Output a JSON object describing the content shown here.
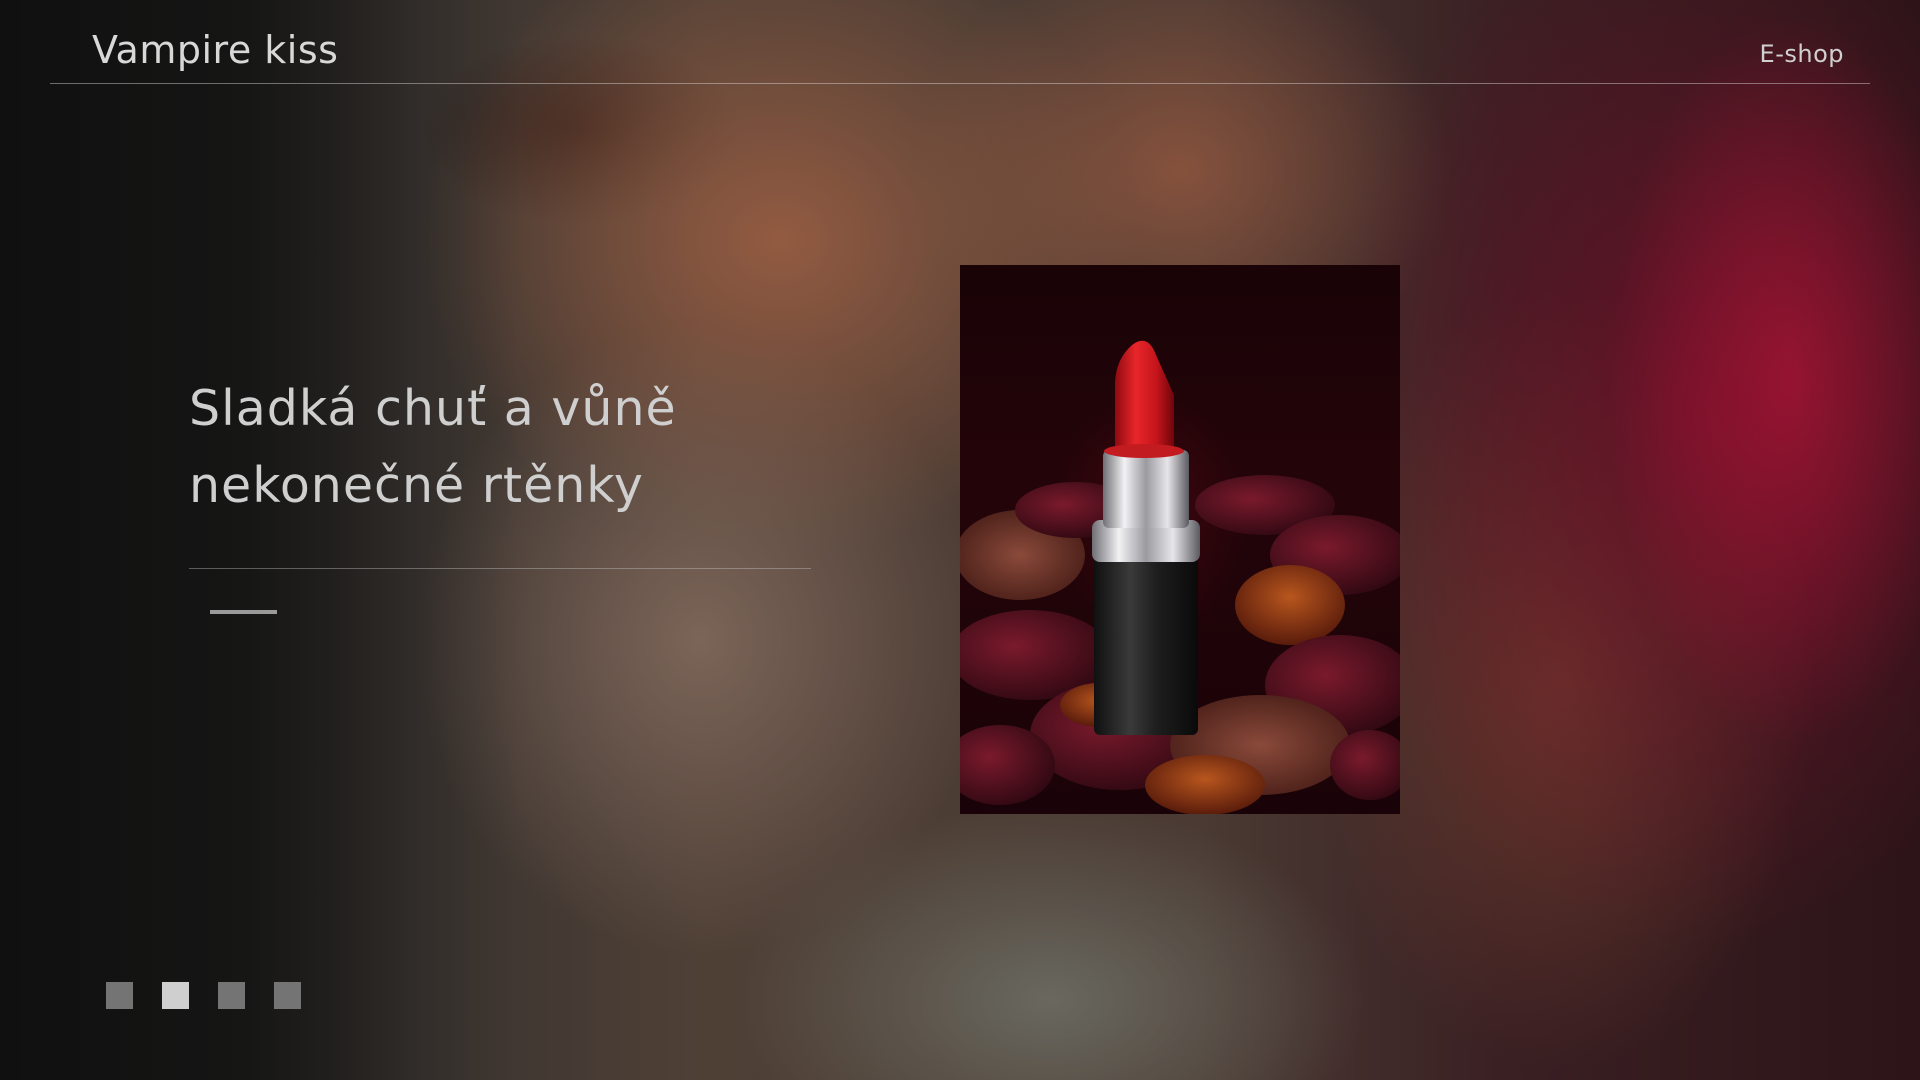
{
  "header": {
    "brand": "Vampire kiss",
    "nav_link": "E-shop"
  },
  "hero": {
    "headline_line1": "Sladká chuť  a vůně",
    "headline_line2": "nekonečné rtěnky"
  },
  "pager": {
    "count": 4,
    "active_index": 1
  },
  "colors": {
    "text": "#cfcfcf",
    "lipstick_red": "#d81e22",
    "pager_inactive": "#747474",
    "pager_active": "#cfcfcf"
  }
}
